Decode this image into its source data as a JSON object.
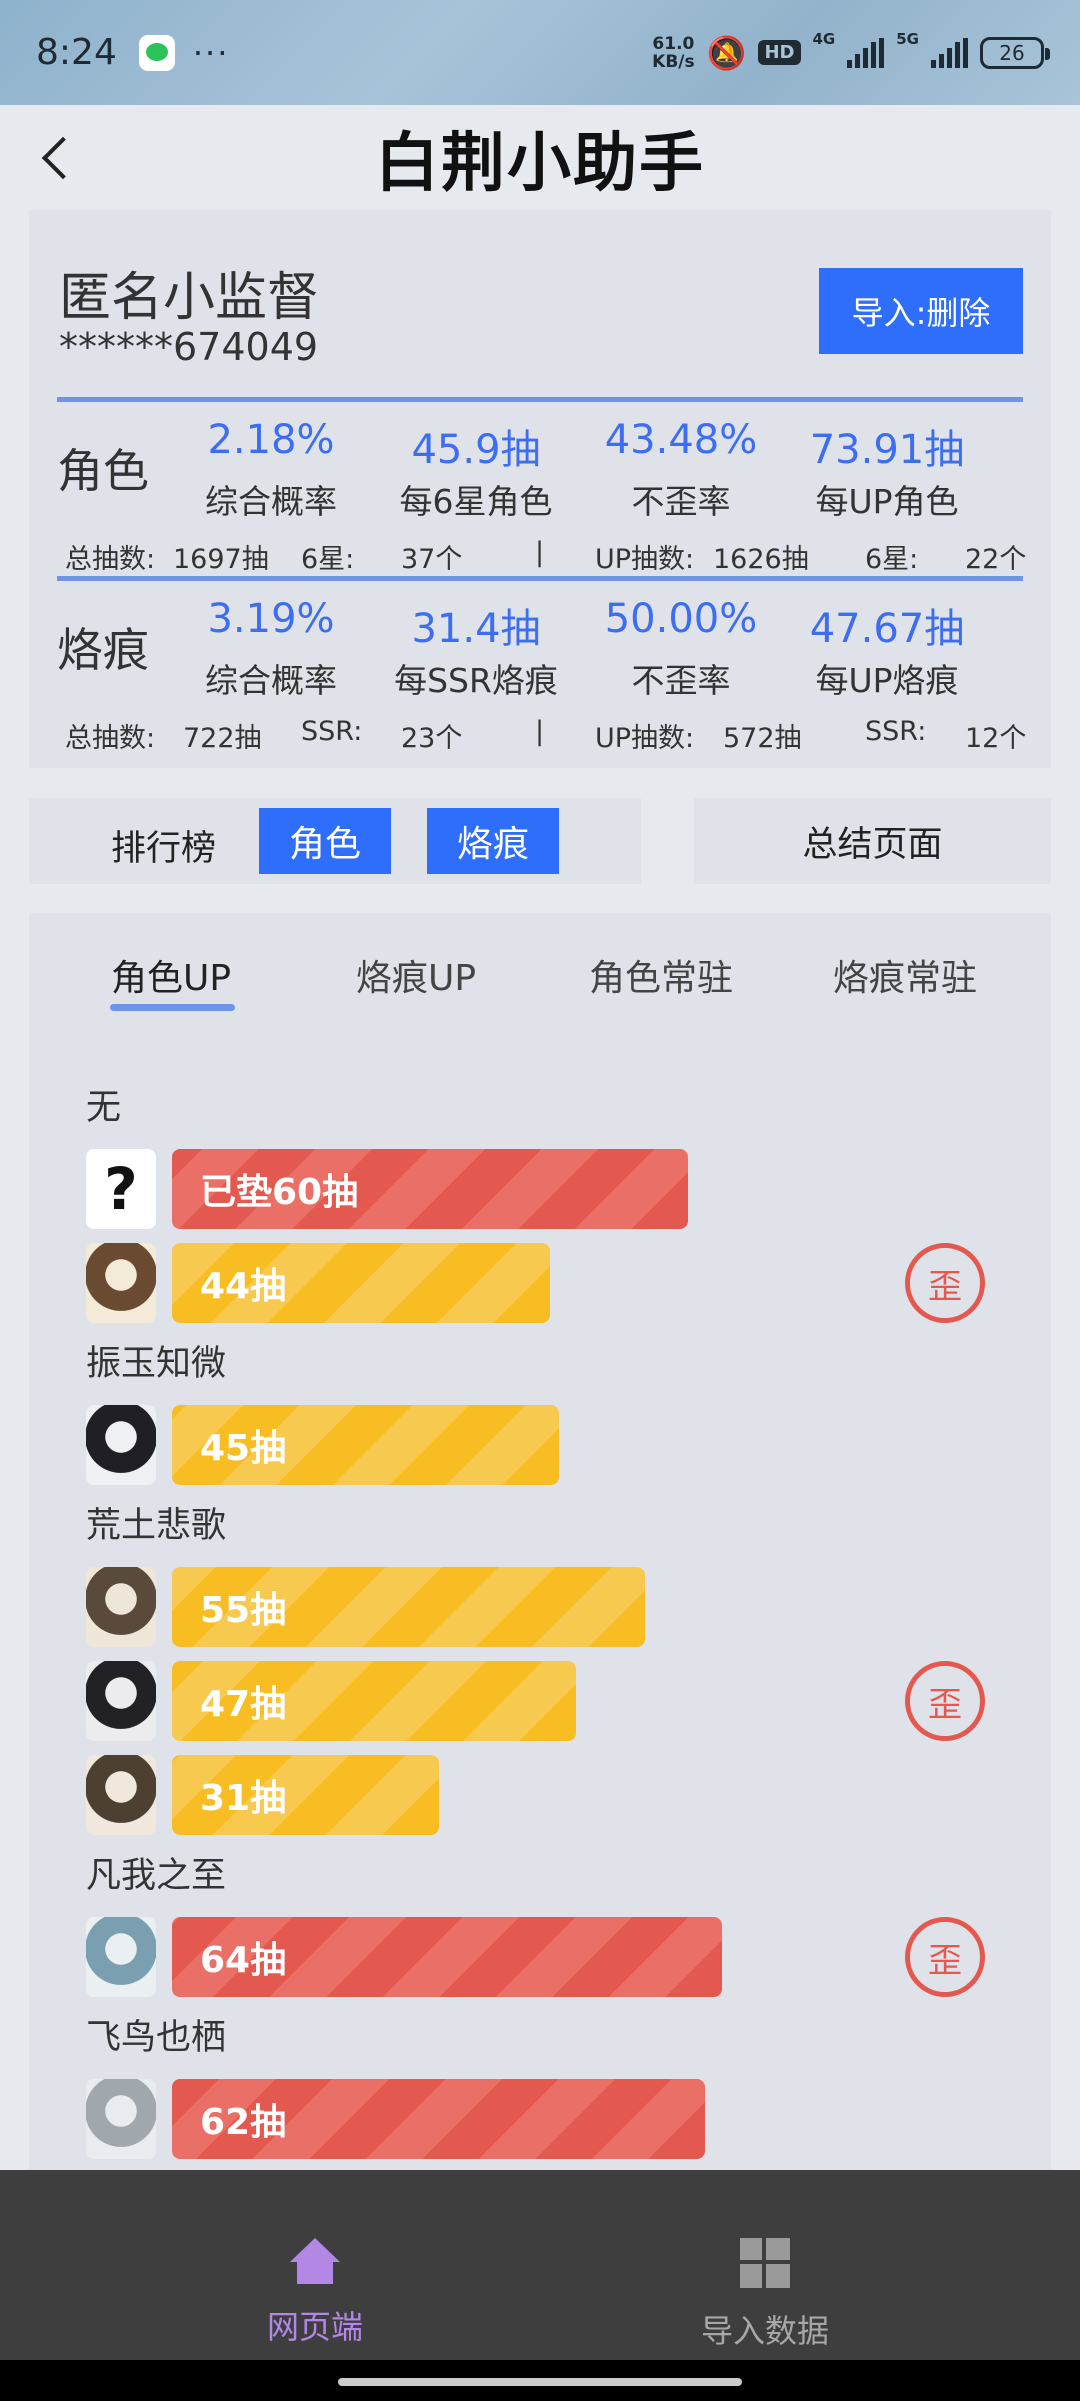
{
  "status_bar": {
    "time": "8:24",
    "dots": "···",
    "speed_top": "61.0",
    "speed_bottom": "KB/s",
    "hd": "HD",
    "net1": "4G",
    "net2": "5G",
    "battery": "26"
  },
  "header": {
    "title": "白荆小助手"
  },
  "user": {
    "name": "匿名小监督",
    "id": "******674049",
    "import_button": "导入:删除"
  },
  "stats": {
    "character": {
      "label": "角色",
      "cols": [
        {
          "value": "2.18%",
          "label": "综合概率"
        },
        {
          "value": "45.9抽",
          "label": "每6星角色"
        },
        {
          "value": "43.48%",
          "label": "不歪率"
        },
        {
          "value": "73.91抽",
          "label": "每UP角色"
        }
      ],
      "totals": {
        "total_label": "总抽数:",
        "total_value": "1697抽",
        "star_label": "6星:",
        "star_value": "37个",
        "sep": "|",
        "up_label": "UP抽数:",
        "up_value": "1626抽",
        "up_star_label": "6星:",
        "up_star_value": "22个"
      }
    },
    "imprint": {
      "label": "烙痕",
      "cols": [
        {
          "value": "3.19%",
          "label": "综合概率"
        },
        {
          "value": "31.4抽",
          "label": "每SSR烙痕"
        },
        {
          "value": "50.00%",
          "label": "不歪率"
        },
        {
          "value": "47.67抽",
          "label": "每UP烙痕"
        }
      ],
      "totals": {
        "total_label": "总抽数:",
        "total_value": "722抽",
        "star_label": "SSR:",
        "star_value": "23个",
        "sep": "|",
        "up_label": "UP抽数:",
        "up_value": "572抽",
        "up_star_label": "SSR:",
        "up_star_value": "12个"
      }
    }
  },
  "rank": {
    "label": "排行榜",
    "chip1": "角色",
    "chip2": "烙痕",
    "summary_button": "总结页面"
  },
  "tabs": [
    "角色UP",
    "烙痕UP",
    "角色常驻",
    "烙痕常驻"
  ],
  "groups": [
    {
      "title": "无",
      "rows": [
        {
          "text": "已垫60抽",
          "pulls": 60,
          "color": "red",
          "unknown": true
        },
        {
          "text": "44抽",
          "pulls": 44,
          "color": "yellow"
        }
      ],
      "wai": "歪"
    },
    {
      "title": "振玉知微",
      "rows": [
        {
          "text": "45抽",
          "pulls": 45,
          "color": "yellow"
        }
      ]
    },
    {
      "title": "荒土悲歌",
      "rows": [
        {
          "text": "55抽",
          "pulls": 55,
          "color": "yellow"
        },
        {
          "text": "47抽",
          "pulls": 47,
          "color": "yellow"
        },
        {
          "text": "31抽",
          "pulls": 31,
          "color": "yellow"
        }
      ],
      "wai": "歪"
    },
    {
      "title": "凡我之至",
      "rows": [
        {
          "text": "64抽",
          "pulls": 64,
          "color": "red"
        }
      ],
      "wai": "歪"
    },
    {
      "title": "飞鸟也栖",
      "rows": [
        {
          "text": "62抽",
          "pulls": 62,
          "color": "red"
        }
      ]
    }
  ],
  "nav": {
    "web": "网页端",
    "import": "导入数据"
  }
}
